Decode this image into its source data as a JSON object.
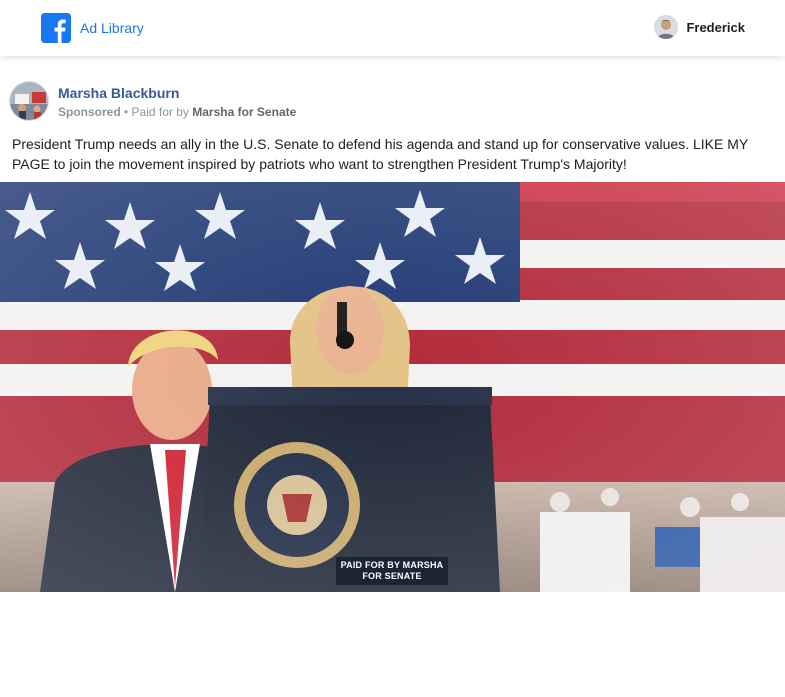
{
  "topbar": {
    "logo_icon": "facebook-icon",
    "ad_library_label": "Ad Library",
    "user_name": "Frederick",
    "brand_color": "#1877f2"
  },
  "post": {
    "page_name": "Marsha Blackburn",
    "sponsored_label": "Sponsored",
    "paid_for_prefix": " • Paid for by ",
    "payer": "Marsha for Senate",
    "text": "President Trump needs an ally in the U.S. Senate to defend his agenda and stand up for conservative values. LIKE MY PAGE to join the movement inspired by patriots who want to strengthen President Trump's Majority!",
    "image": {
      "paid_label_line1": "PAID FOR BY MARSHA",
      "paid_label_line2": "FOR SENATE"
    }
  }
}
